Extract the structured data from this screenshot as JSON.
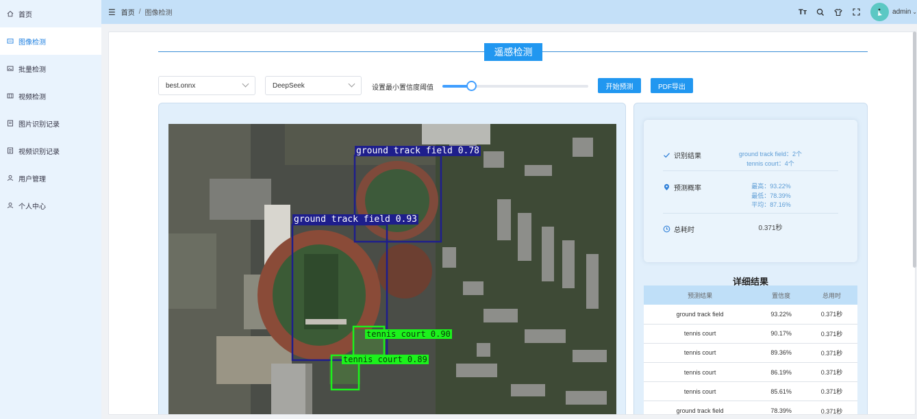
{
  "sidebar": {
    "items": [
      {
        "label": "首页",
        "icon": "home-icon"
      },
      {
        "label": "图像检测",
        "icon": "image-icon"
      },
      {
        "label": "批量检测",
        "icon": "images-icon"
      },
      {
        "label": "视频检测",
        "icon": "video-icon"
      },
      {
        "label": "图片识别记录",
        "icon": "document-icon"
      },
      {
        "label": "视频识别记录",
        "icon": "document-icon"
      },
      {
        "label": "用户管理",
        "icon": "user-icon"
      },
      {
        "label": "个人中心",
        "icon": "user-icon"
      }
    ],
    "active_index": 1
  },
  "header": {
    "breadcrumb": [
      "首页",
      "图像检测"
    ],
    "user": "admin"
  },
  "main": {
    "title": "遥感检测",
    "model_select": "best.onnx",
    "llm_select": "DeepSeek",
    "slider_label": "设置最小置信度阈值",
    "slider_value": 0.2,
    "predict_button": "开始预测",
    "pdf_button": "PDF导出"
  },
  "detections": [
    {
      "label": "ground track field 0.78",
      "color": "#1e1e8c"
    },
    {
      "label": "ground track field 0.93",
      "color": "#1e1e8c"
    },
    {
      "label": "tennis court 0.90",
      "color": "#1cf21c"
    },
    {
      "label": "tennis court 0.89",
      "color": "#1cf21c"
    }
  ],
  "summary": {
    "result_label": "识别结果",
    "result_lines": [
      "ground track field：2个",
      "tennis court：4个"
    ],
    "prob_label": "预测概率",
    "prob_lines": [
      "最高：93.22%",
      "最低：78.39%",
      "平均：87.16%"
    ],
    "time_label": "总耗时",
    "time_value": "0.371秒"
  },
  "detail": {
    "title": "详细结果",
    "headers": [
      "预测结果",
      "置信度",
      "总用时"
    ],
    "rows": [
      [
        "ground track field",
        "93.22%",
        "0.371秒"
      ],
      [
        "tennis court",
        "90.17%",
        "0.371秒"
      ],
      [
        "tennis court",
        "89.36%",
        "0.371秒"
      ],
      [
        "tennis court",
        "86.19%",
        "0.371秒"
      ],
      [
        "tennis court",
        "85.61%",
        "0.371秒"
      ],
      [
        "ground track field",
        "78.39%",
        "0.371秒"
      ]
    ]
  },
  "colors": {
    "accent": "#2197f0",
    "sidebar_bg": "#e9f3fd",
    "header_bg": "#c4e0f8"
  }
}
